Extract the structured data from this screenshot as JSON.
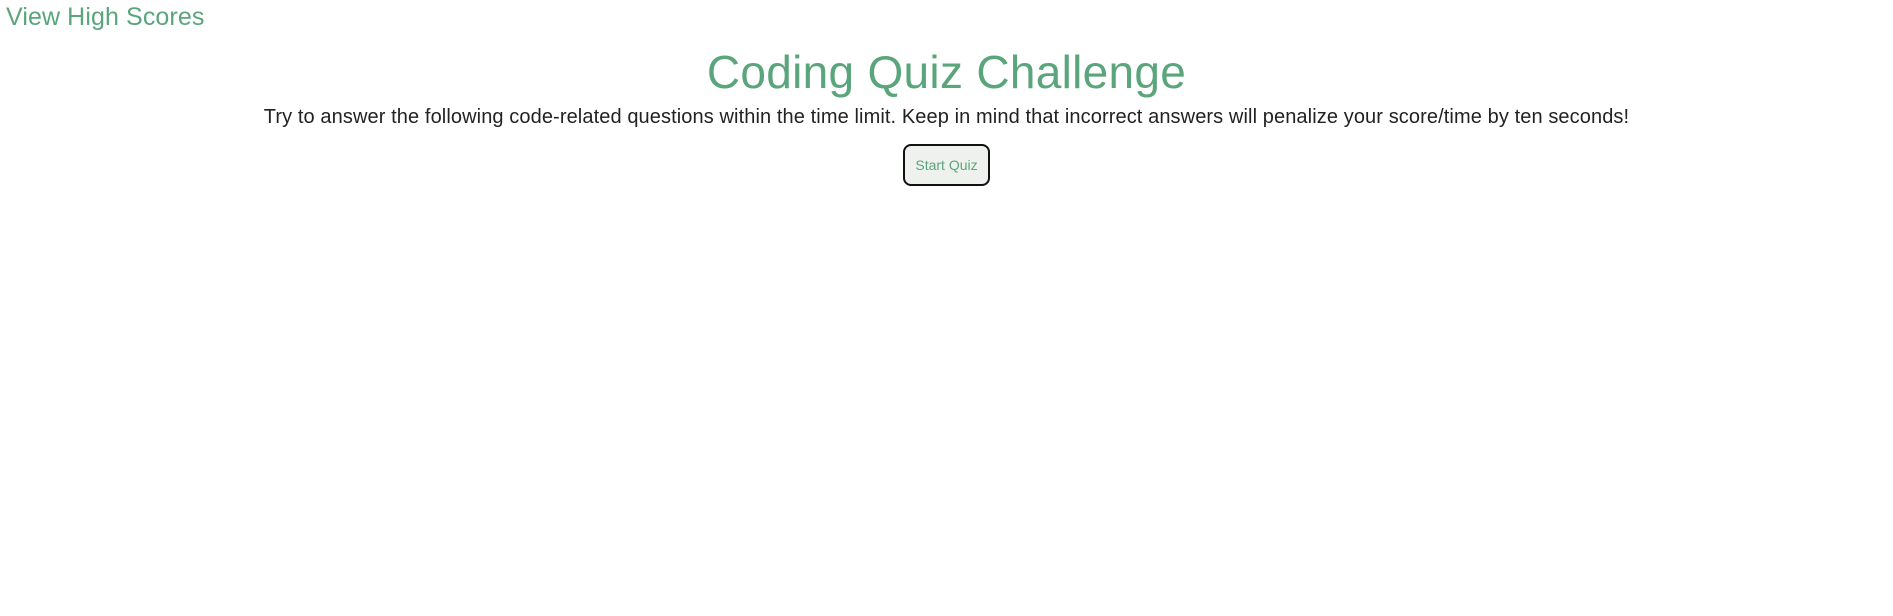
{
  "header": {
    "high_scores_label": "View High Scores"
  },
  "main": {
    "title": "Coding Quiz Challenge",
    "intro": "Try to answer the following code-related questions within the time limit. Keep in mind that incorrect answers will penalize your score/time by ten seconds!",
    "start_label": "Start Quiz"
  },
  "colors": {
    "accent": "#5aa57b",
    "text": "#222222",
    "button_bg": "#eef1ee",
    "button_border": "#111111"
  }
}
